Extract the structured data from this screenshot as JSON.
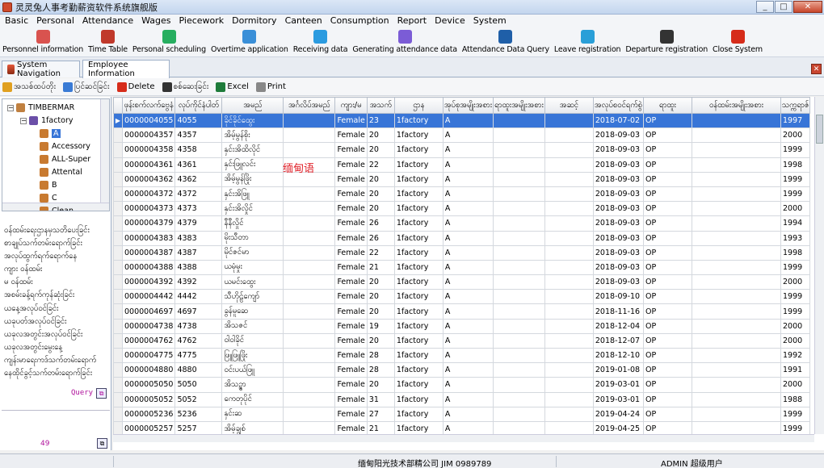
{
  "window": {
    "title": "灵灵兔人事考勤薪资软件系统旗舰版",
    "min": "_",
    "max": "□",
    "close": "✕"
  },
  "menu": [
    "Basic",
    "Personal",
    "Attendance",
    "Wages",
    "Piecework",
    "Dormitory",
    "Canteen",
    "Consumption",
    "Report",
    "Device",
    "System"
  ],
  "toolbar": [
    {
      "label": "Personnel information",
      "icon": "people-icon",
      "color": "#d9534f"
    },
    {
      "label": "Time Table",
      "icon": "clock-icon",
      "color": "#c0392b"
    },
    {
      "label": "Personal scheduling",
      "icon": "grid-icon",
      "color": "#27ae60"
    },
    {
      "label": "Overtime application",
      "icon": "inbox-icon",
      "color": "#3a8fd8"
    },
    {
      "label": "Receiving data",
      "icon": "wifi-icon",
      "color": "#2b9be0"
    },
    {
      "label": "Generating attendance data",
      "icon": "chat-icon",
      "color": "#7b5cd6"
    },
    {
      "label": "Attendance Data Query",
      "icon": "search-icon",
      "color": "#1f5fa8"
    },
    {
      "label": "Leave registration",
      "icon": "q-icon",
      "color": "#2a9fd8"
    },
    {
      "label": "Departure registration",
      "icon": "person-icon",
      "color": "#333333"
    },
    {
      "label": "Close System",
      "icon": "power-icon",
      "color": "#d62c1a"
    }
  ],
  "tabs": {
    "system_nav": "System Navigation",
    "employee_info": "Employee Information",
    "close": "✕"
  },
  "actions": [
    {
      "label": "အသစ်ထပ်တိုး",
      "icon": "add-icon",
      "color": "#e0a020"
    },
    {
      "label": "ပြင်ဆင်ခြင်း",
      "icon": "edit-icon",
      "color": "#3a7bd5"
    },
    {
      "label": "Delete",
      "icon": "delete-icon",
      "color": "#d62c1a"
    },
    {
      "label": "စစ်ဆေးခြင်း",
      "icon": "binoculars-icon",
      "color": "#333333"
    },
    {
      "label": "Excel",
      "icon": "excel-icon",
      "color": "#1e7b3a"
    },
    {
      "label": "Print",
      "icon": "print-icon",
      "color": "#888888"
    }
  ],
  "tree": {
    "root": "TIMBERMAR",
    "factory": "1factory",
    "children": [
      "A",
      "Accessory",
      "ALL-Super",
      "Attental",
      "B",
      "C",
      "Clean"
    ],
    "selected": "A"
  },
  "left_list": [
    "ဝန်ထမ်းရေးဌာနမှသတိပေးခြင်း",
    "စာချုပ်သက်တမ်းရောက်ခြင်း",
    "အလုပ်ထွက်ရက်ရောက်နေ",
    "ကျား ဝန်ထမ်း",
    "မ ဝန်ထမ်း",
    "အစမ်းခန့်ရက်ကုန်ဆုံးခြင်း",
    "ယနေ့အလုပ်ဝင်ခြင်း",
    "ယခုပတ်အလုပ်ဝင်ခြင်း",
    "ယခုလအတွင်းအလုပ်ဝင်ခြင်း",
    "ယခုလအတွင်းမွေးနေ့",
    "ကျန်းမာရေးကဒ်သက်တမ်းရောက်",
    "နေထိုင်ခွင့်သက်တမ်းရောက်ခြင်း"
  ],
  "query_label": "Query",
  "record_count": "49",
  "columns": [
    "ဖုန်းစက်လက်ဗွေနံ",
    "လုပ်ကိုင်နံပါတ်",
    "အမည်",
    "အင်္ဂလိပ်အမည်",
    "ကျား/မ",
    "အသက်",
    "ဌာန",
    "အုပ်စုအမျိုးအစား",
    "ရာထူးအမျိုးအစား",
    "အဆင့်",
    "အလုပ်စဝင်ရက်စွဲ",
    "ရာထူး",
    "ဝန်ထမ်းအမျိုးအစား",
    "သက္ကရာဇ်"
  ],
  "rows": [
    [
      "0000004055",
      "4055",
      "ခိုင်ခိုင်ထွေး",
      "",
      "Female",
      "23",
      "1factory",
      "A",
      "",
      "",
      "2018-07-02",
      "OP",
      "",
      "1997"
    ],
    [
      "0000004357",
      "4357",
      "အိမ့်မွန်စိုး",
      "",
      "Female",
      "20",
      "1factory",
      "A",
      "",
      "",
      "2018-09-03",
      "OP",
      "",
      "2000"
    ],
    [
      "0000004358",
      "4358",
      "နှင်းအိထိလိုင်",
      "",
      "Female",
      "20",
      "1factory",
      "A",
      "",
      "",
      "2018-09-03",
      "OP",
      "",
      "1999"
    ],
    [
      "0000004361",
      "4361",
      "နှင်းဖြူလင်း",
      "",
      "Female",
      "22",
      "1factory",
      "A",
      "",
      "",
      "2018-09-03",
      "OP",
      "",
      "1998"
    ],
    [
      "0000004362",
      "4362",
      "အိမ့်မွန်ဖြိုး",
      "",
      "Female",
      "20",
      "1factory",
      "A",
      "",
      "",
      "2018-09-03",
      "OP",
      "",
      "1999"
    ],
    [
      "0000004372",
      "4372",
      "နှင်းအိဖြူ",
      "",
      "Female",
      "20",
      "1factory",
      "A",
      "",
      "",
      "2018-09-03",
      "OP",
      "",
      "1999"
    ],
    [
      "0000004373",
      "4373",
      "နှင်းအိလှိုင်",
      "",
      "Female",
      "20",
      "1factory",
      "A",
      "",
      "",
      "2018-09-03",
      "OP",
      "",
      "2000"
    ],
    [
      "0000004379",
      "4379",
      "နီနီလှိုင်",
      "",
      "Female",
      "26",
      "1factory",
      "A",
      "",
      "",
      "2018-09-03",
      "OP",
      "",
      "1994"
    ],
    [
      "0000004383",
      "4383",
      "မိုးသီတာ",
      "",
      "Female",
      "26",
      "1factory",
      "A",
      "",
      "",
      "2018-09-03",
      "OP",
      "",
      "1993"
    ],
    [
      "0000004387",
      "4387",
      "မိုင်ဇင်မာ",
      "",
      "Female",
      "22",
      "1factory",
      "A",
      "",
      "",
      "2018-09-03",
      "OP",
      "",
      "1998"
    ],
    [
      "0000004388",
      "4388",
      "ယမုံမှုး",
      "",
      "Female",
      "21",
      "1factory",
      "A",
      "",
      "",
      "2018-09-03",
      "OP",
      "",
      "1999"
    ],
    [
      "0000004392",
      "4392",
      "ယမင်းထွေး",
      "",
      "Female",
      "20",
      "1factory",
      "A",
      "",
      "",
      "2018-09-03",
      "OP",
      "",
      "2000"
    ],
    [
      "0000004442",
      "4442",
      "သီဟိုဠ်ကျော်",
      "",
      "Female",
      "20",
      "1factory",
      "A",
      "",
      "",
      "2018-09-10",
      "OP",
      "",
      "1999"
    ],
    [
      "0000004697",
      "4697",
      "ခွန်မူဆေ",
      "",
      "Female",
      "20",
      "1factory",
      "A",
      "",
      "",
      "2018-11-16",
      "OP",
      "",
      "1999"
    ],
    [
      "0000004738",
      "4738",
      "အိသဇင်",
      "",
      "Female",
      "19",
      "1factory",
      "A",
      "",
      "",
      "2018-12-04",
      "OP",
      "",
      "2000"
    ],
    [
      "0000004762",
      "4762",
      "ဝါဝါခိုင်",
      "",
      "Female",
      "20",
      "1factory",
      "A",
      "",
      "",
      "2018-12-07",
      "OP",
      "",
      "2000"
    ],
    [
      "0000004775",
      "4775",
      "ဖြူဖြူဖြိုး",
      "",
      "Female",
      "28",
      "1factory",
      "A",
      "",
      "",
      "2018-12-10",
      "OP",
      "",
      "1992"
    ],
    [
      "0000004880",
      "4880",
      "ဝင်းပယ်ဖြူ",
      "",
      "Female",
      "28",
      "1factory",
      "A",
      "",
      "",
      "2019-01-08",
      "OP",
      "",
      "1991"
    ],
    [
      "0000005050",
      "5050",
      "အိသဉ္ဇာ",
      "",
      "Female",
      "20",
      "1factory",
      "A",
      "",
      "",
      "2019-03-01",
      "OP",
      "",
      "2000"
    ],
    [
      "0000005052",
      "5052",
      "ကေတုပိုင်",
      "",
      "Female",
      "31",
      "1factory",
      "A",
      "",
      "",
      "2019-03-01",
      "OP",
      "",
      "1988"
    ],
    [
      "0000005236",
      "5236",
      "နှင်းဆ",
      "",
      "Female",
      "27",
      "1factory",
      "A",
      "",
      "",
      "2019-04-24",
      "OP",
      "",
      "1999"
    ],
    [
      "0000005257",
      "5257",
      "အိမ့်ချွစ်",
      "",
      "Female",
      "21",
      "1factory",
      "A",
      "",
      "",
      "2019-04-25",
      "OP",
      "",
      "1999"
    ]
  ],
  "annotation": "缅甸语",
  "status": {
    "center": "缅甸阳光技术部精公司 JIM 0989789",
    "right": "ADMIN 超级用户"
  }
}
